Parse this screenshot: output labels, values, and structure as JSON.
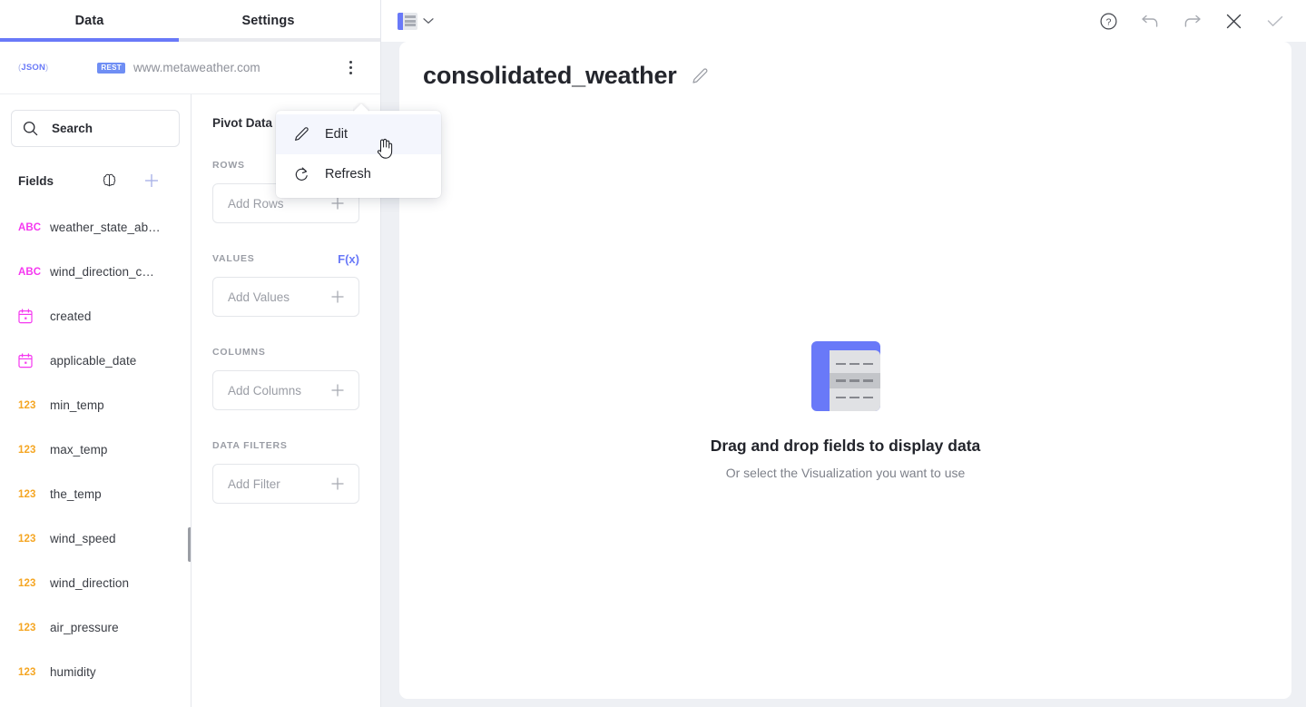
{
  "tabs": [
    {
      "label": "Data",
      "active": true
    },
    {
      "label": "Settings",
      "active": false
    }
  ],
  "source": {
    "json_badge": "JSON",
    "rest_badge": "REST",
    "url": "www.metaweather.com",
    "kebab_name": "more-options"
  },
  "context_menu": {
    "items": [
      {
        "label": "Edit",
        "icon": "pencil-icon",
        "hovered": true
      },
      {
        "label": "Refresh",
        "icon": "refresh-icon",
        "hovered": false
      }
    ]
  },
  "search": {
    "placeholder": "Search",
    "value": "Search"
  },
  "fields_panel": {
    "title": "Fields",
    "brain_icon": "brain-icon",
    "add_icon": "plus-icon",
    "items": [
      {
        "type": "ABC",
        "kind": "abc",
        "name": "weather_state_ab…"
      },
      {
        "type": "ABC",
        "kind": "abc",
        "name": "wind_direction_c…"
      },
      {
        "type": "date",
        "kind": "date",
        "name": "created"
      },
      {
        "type": "date",
        "kind": "date",
        "name": "applicable_date"
      },
      {
        "type": "123",
        "kind": "num",
        "name": "min_temp"
      },
      {
        "type": "123",
        "kind": "num",
        "name": "max_temp"
      },
      {
        "type": "123",
        "kind": "num",
        "name": "the_temp"
      },
      {
        "type": "123",
        "kind": "num",
        "name": "wind_speed"
      },
      {
        "type": "123",
        "kind": "num",
        "name": "wind_direction"
      },
      {
        "type": "123",
        "kind": "num",
        "name": "air_pressure"
      },
      {
        "type": "123",
        "kind": "num",
        "name": "humidity"
      }
    ]
  },
  "pivot": {
    "title": "Pivot Data",
    "fx_label": "F(x)",
    "sections": [
      {
        "label": "ROWS",
        "placeholder": "Add Rows"
      },
      {
        "label": "VALUES",
        "placeholder": "Add Values"
      },
      {
        "label": "COLUMNS",
        "placeholder": "Add Columns"
      },
      {
        "label": "DATA FILTERS",
        "placeholder": "Add Filter"
      }
    ]
  },
  "toolbar": {
    "viz_picker": "table-viz-icon",
    "help": "help-icon",
    "undo": "undo-icon",
    "redo": "redo-icon",
    "close": "close-icon",
    "confirm": "check-icon"
  },
  "document": {
    "title": "consolidated_weather",
    "edit_icon": "pencil-icon"
  },
  "empty_state": {
    "heading": "Drag and drop fields to display data",
    "subheading": "Or select the Visualization you want to use"
  },
  "colors": {
    "accent": "#6979f8",
    "text_type": "#f538f0",
    "num_type": "#f5a623",
    "canvas_bg": "#eef0f4"
  }
}
